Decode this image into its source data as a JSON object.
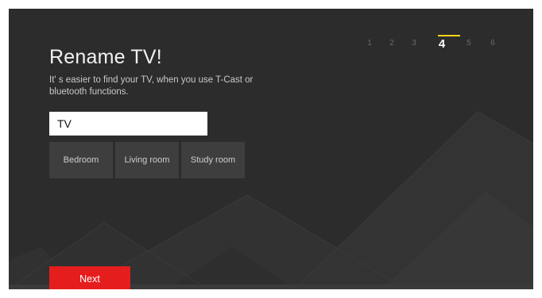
{
  "setup": {
    "title": "Rename TV!",
    "subtitle": "It' s easier to find your TV, when you use T-Cast or bluetooth functions.",
    "name_value": "TV",
    "presets": [
      "Bedroom",
      "Living room",
      "Study room"
    ],
    "steps": [
      "1",
      "2",
      "3",
      "4",
      "5",
      "6"
    ],
    "current_step": "4",
    "next_label": "Next"
  },
  "colors": {
    "background": "#2c2c2c",
    "accent_yellow": "#f4d31c",
    "button_red": "#e61d1d"
  }
}
